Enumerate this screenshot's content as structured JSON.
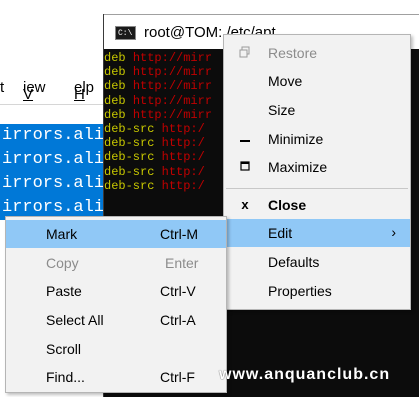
{
  "background_window": {
    "menu": [
      "t",
      "View",
      "Help"
    ],
    "lines": [
      "irrors.aliy",
      "irrors.aliy",
      "irrors.aliy",
      "irrors.aliy"
    ]
  },
  "console": {
    "title": "root@TOM: /etc/apt",
    "icon_text": "C:\\",
    "lines": [
      {
        "kw": "deb",
        "url": "http://mirr"
      },
      {
        "kw": "deb",
        "url": "http://mirr"
      },
      {
        "kw": "deb",
        "url": "http://mirr"
      },
      {
        "kw": "deb",
        "url": "http://mirr"
      },
      {
        "kw": "deb",
        "url": "http://mirr"
      },
      {
        "kw": "deb-src",
        "url": "http:/"
      },
      {
        "kw": "deb-src",
        "url": "http:/"
      },
      {
        "kw": "deb-src",
        "url": "http:/"
      },
      {
        "kw": "deb-src",
        "url": "http:/"
      },
      {
        "kw": "deb-src",
        "url": "http:/"
      }
    ]
  },
  "system_menu": {
    "items": [
      {
        "label": "Restore",
        "icon": "restore-icon",
        "disabled": true
      },
      {
        "label": "Move",
        "icon": "",
        "disabled": false
      },
      {
        "label": "Size",
        "icon": "",
        "disabled": false
      },
      {
        "label": "Minimize",
        "icon": "minimize-icon",
        "disabled": false
      },
      {
        "label": "Maximize",
        "icon": "maximize-icon",
        "disabled": false
      },
      {
        "label": "Close",
        "icon": "close-icon",
        "disabled": false,
        "bold": true
      },
      {
        "label": "Edit",
        "icon": "",
        "disabled": false,
        "submenu": true,
        "highlight": true
      },
      {
        "label": "Defaults",
        "icon": "",
        "disabled": false
      },
      {
        "label": "Properties",
        "icon": "",
        "disabled": false
      }
    ]
  },
  "edit_submenu": {
    "items": [
      {
        "label": "Mark",
        "shortcut": "Ctrl-M",
        "highlight": true
      },
      {
        "label": "Copy",
        "shortcut": "Enter",
        "disabled": true
      },
      {
        "label": "Paste",
        "shortcut": "Ctrl-V"
      },
      {
        "label": "Select All",
        "shortcut": "Ctrl-A"
      },
      {
        "label": "Scroll",
        "shortcut": ""
      },
      {
        "label": "Find...",
        "shortcut": "Ctrl-F"
      }
    ]
  },
  "watermark": "www.anquanclub.cn",
  "colors": {
    "highlight": "#90c8f6",
    "selection": "#0078d7",
    "console_bg": "#0c0c0c",
    "keyword": "#c8c800",
    "url": "#c00000",
    "disabled": "#8c8c8c"
  }
}
